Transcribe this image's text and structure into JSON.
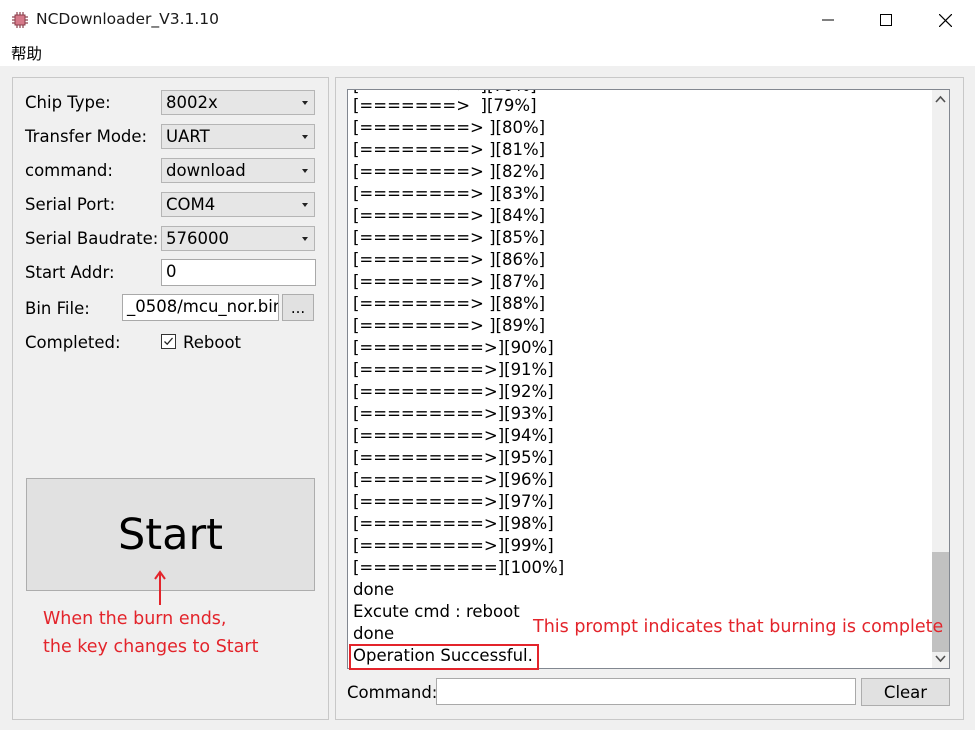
{
  "window": {
    "title": "NCDownloader_V3.1.10"
  },
  "menu": {
    "items": [
      "帮助"
    ]
  },
  "settings": {
    "chip_type": {
      "label": "Chip Type:",
      "value": "8002x"
    },
    "transfer_mode": {
      "label": "Transfer Mode:",
      "value": "UART"
    },
    "command": {
      "label": "command:",
      "value": "download"
    },
    "serial_port": {
      "label": "Serial Port:",
      "value": "COM4"
    },
    "baudrate": {
      "label": "Serial Baudrate:",
      "value": "576000"
    },
    "start_addr": {
      "label": "Start Addr:",
      "value": "0"
    },
    "bin_file": {
      "label": "Bin File:",
      "value": "_0508/mcu_nor.bin",
      "browse_label": "..."
    },
    "completed": {
      "label": "Completed:",
      "reboot_label": "Reboot",
      "reboot_checked": true
    }
  },
  "start_button": {
    "label": "Start"
  },
  "annotations": {
    "start_note_line1": "When the burn ends,",
    "start_note_line2": "the key changes to Start",
    "log_note": "This prompt indicates that burning is complete",
    "color": "#e3242b"
  },
  "log": {
    "lines": [
      "[=======>  ][79%]",
      "[========> ][80%]",
      "[========> ][81%]",
      "[========> ][82%]",
      "[========> ][83%]",
      "[========> ][84%]",
      "[========> ][85%]",
      "[========> ][86%]",
      "[========> ][87%]",
      "[========> ][88%]",
      "[========> ][89%]",
      "[=========>][90%]",
      "[=========>][91%]",
      "[=========>][92%]",
      "[=========>][93%]",
      "[=========>][94%]",
      "[=========>][95%]",
      "[=========>][96%]",
      "[=========>][97%]",
      "[=========>][98%]",
      "[=========>][99%]",
      "[==========][100%]",
      "done",
      "Excute cmd : reboot",
      "done",
      "Operation Successful."
    ]
  },
  "command_bar": {
    "label": "Command:",
    "value": "",
    "clear_label": "Clear"
  },
  "icons": {
    "app": "chip-icon",
    "minimize": "minimize-icon",
    "maximize": "maximize-icon",
    "close": "close-icon"
  }
}
